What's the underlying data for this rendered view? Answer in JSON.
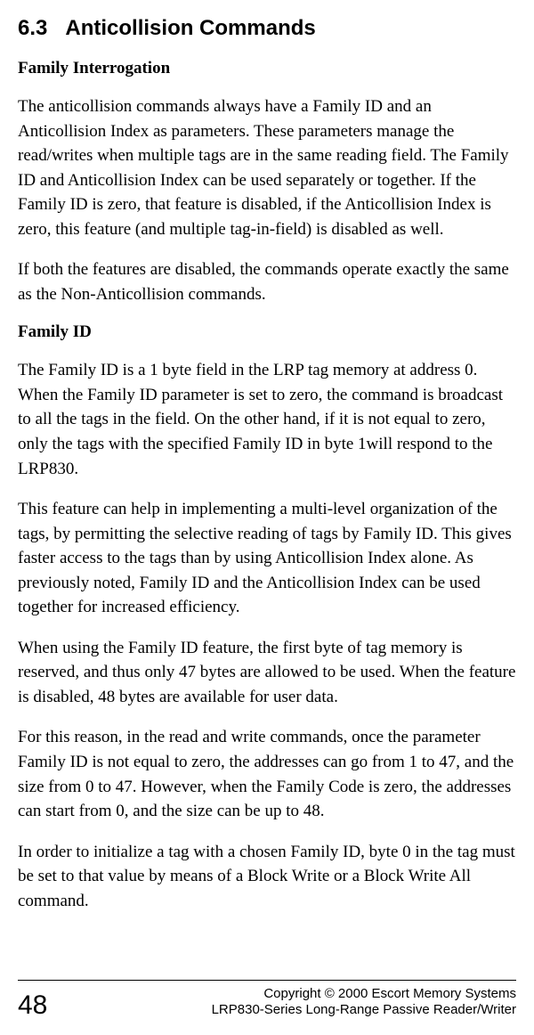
{
  "section": {
    "number": "6.3",
    "title": "Anticollision Commands"
  },
  "subheadings": {
    "family_interrogation": "Family Interrogation",
    "family_id": "Family ID"
  },
  "paragraphs": {
    "p1": "The anticollision commands always have a Family ID and an Anticollision Index as parameters.  These parameters manage the read/writes when multiple tags are in the same reading field. The Family ID and Anticollision Index can be used separately or together.  If the Family ID is zero, that feature is disabled, if the Anticollision Index is zero, this feature (and multiple tag-in-field) is disabled as well.",
    "p2": "If both the features are disabled, the commands operate exactly the same as the Non-Anticollision commands.",
    "p3": "The Family ID is a 1 byte field in the LRP tag memory at address 0. When the Family ID parameter is set to zero, the command is broadcast to all the tags in the field. On the other hand, if it is not equal to zero, only the tags with the specified Family ID in byte 1will respond to the LRP830.",
    "p4": "This feature can help in implementing a multi-level organization of the tags, by permitting the selective reading of tags by Family ID. This gives faster access to the tags than by using Anticollision Index alone. As previously noted, Family ID and the Anticollision Index can be used together for increased efficiency.",
    "p5": "When using the Family ID feature, the first byte of tag memory is reserved, and thus only 47 bytes are allowed to be used. When the feature is disabled, 48 bytes are available for user data.",
    "p6": "For this reason, in the read and write commands, once the parameter Family ID is not equal to zero, the addresses can go from 1 to 47, and the size from 0 to 47. However, when the Family Code is zero, the addresses can start from 0, and the size can be up to 48.",
    "p7": "In order to initialize a tag with a chosen Family ID, byte 0 in the tag must be set to that value by means of a Block Write or a Block Write All command."
  },
  "footer": {
    "page_number": "48",
    "copyright_line1": "Copyright © 2000 Escort Memory Systems",
    "copyright_line2": "LRP830-Series Long-Range Passive Reader/Writer"
  }
}
